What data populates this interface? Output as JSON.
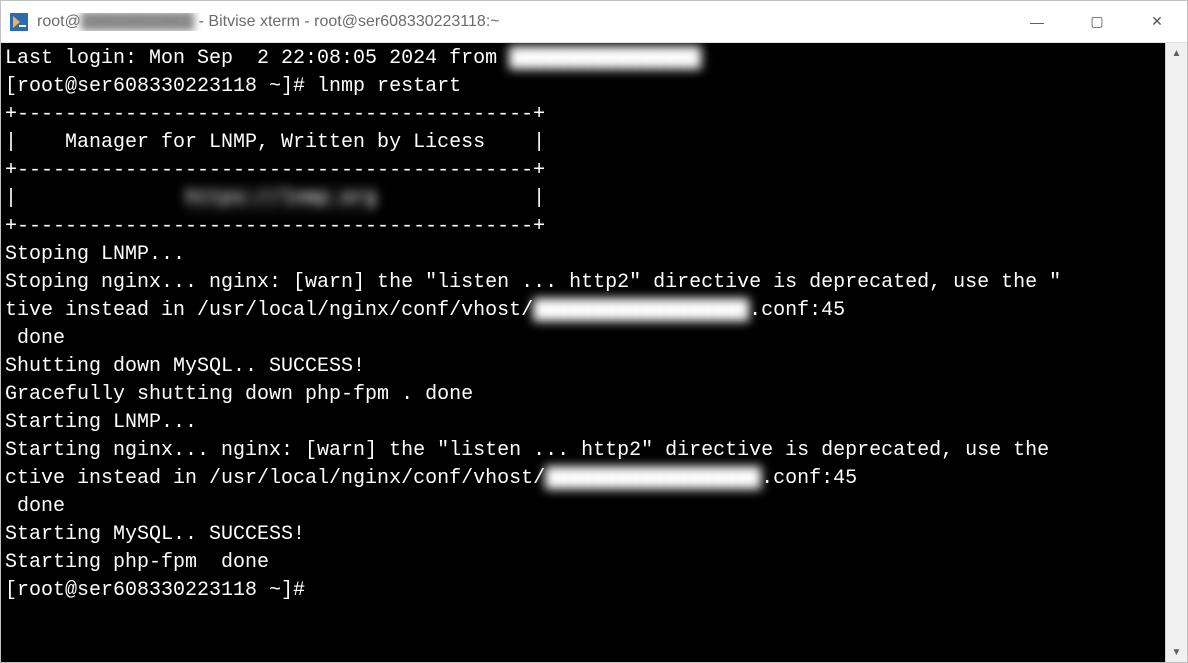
{
  "titlebar": {
    "prefix": "root@",
    "obscured_host": "██████████",
    "suffix": " - Bitvise xterm - root@ser608330223118:~"
  },
  "window_controls": {
    "minimize": "—",
    "maximize": "▢",
    "close": "✕"
  },
  "terminal": {
    "l0a": "Last login: Mon Sep  2 22:08:05 2024 from ",
    "l0b": "████████████████",
    "l1": "[root@ser608330223118 ~]# lnmp restart",
    "l2": "+-------------------------------------------+",
    "l3": "|    Manager for LNMP, Written by Licess    |",
    "l4": "+-------------------------------------------+",
    "l5a": "|              ",
    "l5b": "https://lnmp.org",
    "l5c": "             |",
    "l6": "+-------------------------------------------+",
    "l7": "Stoping LNMP...",
    "l8": "Stoping nginx... nginx: [warn] the \"listen ... http2\" directive is deprecated, use the \"",
    "l9a": "tive instead in /usr/local/nginx/conf/vhost/",
    "l9b": "██████████████████",
    "l9c": ".conf:45",
    "l10": " done",
    "l11": "Shutting down MySQL.. SUCCESS!",
    "l12": "Gracefully shutting down php-fpm . done",
    "l13": "Starting LNMP...",
    "l14": "Starting nginx... nginx: [warn] the \"listen ... http2\" directive is deprecated, use the ",
    "l15a": "ctive instead in /usr/local/nginx/conf/vhost/",
    "l15b": "██████████████████",
    "l15c": ".conf:45",
    "l16": " done",
    "l17": "Starting MySQL.. SUCCESS!",
    "l18": "Starting php-fpm  done",
    "l19": "[root@ser608330223118 ~]#"
  },
  "scrollbar": {
    "up": "▲",
    "down": "▼"
  }
}
